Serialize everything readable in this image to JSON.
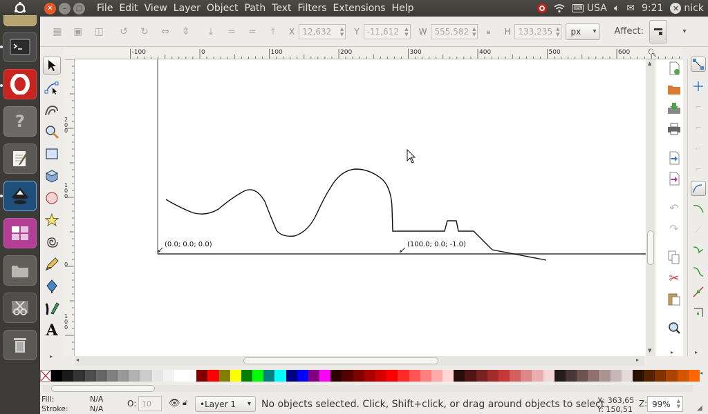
{
  "topbar": {
    "menus": [
      "File",
      "Edit",
      "View",
      "Layer",
      "Object",
      "Path",
      "Text",
      "Filters",
      "Extensions",
      "Help"
    ],
    "keyboard_layout": "USA",
    "time": "9:21",
    "user": "nick"
  },
  "launcher": {
    "apps": [
      "terminal-app",
      "opera-app",
      "help-app",
      "text-editor-app",
      "inkscape-app",
      "workspace-switcher-app",
      "files-app",
      "screenshot-app",
      "trash-app"
    ]
  },
  "toolbar": {
    "x_label": "X",
    "x_value": "12,632",
    "y_label": "Y",
    "y_value": "-11,612",
    "w_label": "W",
    "w_value": "555,582",
    "h_label": "H",
    "h_value": "133,235",
    "unit": "px",
    "affect_label": "Affect:"
  },
  "ruler": {
    "top_labels": [
      "-100",
      "0",
      "100",
      "200",
      "300",
      "400",
      "500",
      "600",
      "70"
    ],
    "left_labels": [
      "2",
      "0",
      "0",
      "1",
      "0",
      "0",
      "0",
      "1",
      "0",
      "0"
    ]
  },
  "canvas": {
    "annotation_origin": "(0.0; 0.0; 0.0)",
    "annotation_end": "(100.0; 0.0; -1.0)"
  },
  "palette": {
    "colors": [
      "#000000",
      "#1a1a1a",
      "#333333",
      "#4d4d4d",
      "#666666",
      "#808080",
      "#999999",
      "#b3b3b3",
      "#cccccc",
      "#e6e6e6",
      "#f2f2f2",
      "#ffffff",
      "#ffffff",
      "#800000",
      "#ff0000",
      "#808000",
      "#ffff00",
      "#008000",
      "#00ff00",
      "#008080",
      "#00ffff",
      "#000080",
      "#0000ff",
      "#800080",
      "#ff00ff",
      "#2b0000",
      "#550000",
      "#800000",
      "#aa0000",
      "#d40000",
      "#ff0000",
      "#ff2a2a",
      "#ff5555",
      "#ff8080",
      "#ffaaaa",
      "#ffd5d5",
      "#280b0b",
      "#501616",
      "#782121",
      "#a02c2c",
      "#c83737",
      "#d35f5f",
      "#de8787",
      "#e9afaf",
      "#f4d7d7",
      "#241c1c",
      "#483737",
      "#6c5353",
      "#916f6f",
      "#ac9393",
      "#c8b7b7",
      "#e3dbdb",
      "#2b1100",
      "#552200",
      "#803300",
      "#aa4400",
      "#d45500",
      "#ff6600"
    ]
  },
  "status": {
    "fill_label": "Fill:",
    "fill_value": "N/A",
    "stroke_label": "Stroke:",
    "stroke_value": "N/A",
    "opacity_label": "O:",
    "opacity_value": "10",
    "layer": "•Layer 1",
    "message": "No objects selected. Click, Shift+click, or drag around objects to select.",
    "x_coord": "X:  363,65",
    "y_coord": "Y:  150,51",
    "zoom_label": "Z:",
    "zoom_value": "99%"
  }
}
